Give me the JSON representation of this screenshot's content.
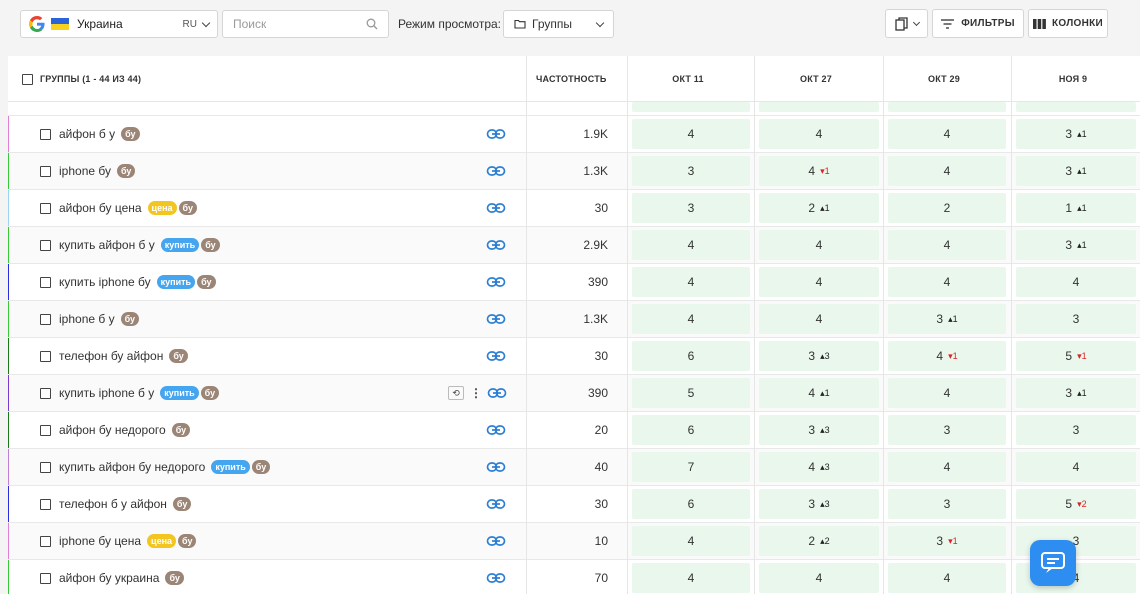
{
  "toolbar": {
    "region_name": "Украина",
    "region_lang": "RU",
    "search_placeholder": "Поиск",
    "view_mode_label": "Режим просмотра:",
    "view_mode_value": "Группы",
    "filters_label": "ФИЛЬТРЫ",
    "columns_label": "КОЛОНКИ"
  },
  "table": {
    "header_groups": "ГРУППЫ (1 - 44 ИЗ 44)",
    "header_freq": "ЧАСТОТНОСТЬ",
    "dates": [
      "ОКТ 11",
      "ОКТ 27",
      "ОКТ 29",
      "НОЯ 9"
    ],
    "rows": [
      {
        "kw": "айфон б у",
        "tags": [
          "бу"
        ],
        "freq": "1.9K",
        "pos": [
          {
            "v": "4"
          },
          {
            "v": "4"
          },
          {
            "v": "4"
          },
          {
            "v": "3",
            "d": "1",
            "dir": "up"
          }
        ]
      },
      {
        "kw": "iphone бу",
        "tags": [
          "бу"
        ],
        "freq": "1.3K",
        "pos": [
          {
            "v": "3"
          },
          {
            "v": "4",
            "d": "1",
            "dir": "down"
          },
          {
            "v": "4"
          },
          {
            "v": "3",
            "d": "1",
            "dir": "up"
          }
        ]
      },
      {
        "kw": "айфон бу цена",
        "tags": [
          "цена",
          "бу"
        ],
        "freq": "30",
        "pos": [
          {
            "v": "3"
          },
          {
            "v": "2",
            "d": "1",
            "dir": "up"
          },
          {
            "v": "2"
          },
          {
            "v": "1",
            "d": "1",
            "dir": "up"
          }
        ]
      },
      {
        "kw": "купить айфон б у",
        "tags": [
          "купить",
          "бу"
        ],
        "freq": "2.9K",
        "pos": [
          {
            "v": "4"
          },
          {
            "v": "4"
          },
          {
            "v": "4"
          },
          {
            "v": "3",
            "d": "1",
            "dir": "up"
          }
        ]
      },
      {
        "kw": "купить iphone бу",
        "tags": [
          "купить",
          "бу"
        ],
        "freq": "390",
        "pos": [
          {
            "v": "4"
          },
          {
            "v": "4"
          },
          {
            "v": "4"
          },
          {
            "v": "4"
          }
        ]
      },
      {
        "kw": "iphone б у",
        "tags": [
          "бу"
        ],
        "freq": "1.3K",
        "pos": [
          {
            "v": "4"
          },
          {
            "v": "4"
          },
          {
            "v": "3",
            "d": "1",
            "dir": "up"
          },
          {
            "v": "3"
          }
        ]
      },
      {
        "kw": "телефон бу айфон",
        "tags": [
          "бу"
        ],
        "freq": "30",
        "pos": [
          {
            "v": "6"
          },
          {
            "v": "3",
            "d": "3",
            "dir": "up"
          },
          {
            "v": "4",
            "d": "1",
            "dir": "down"
          },
          {
            "v": "5",
            "d": "1",
            "dir": "down"
          }
        ]
      },
      {
        "kw": "купить iphone б у",
        "tags": [
          "купить",
          "бу"
        ],
        "freq": "390",
        "pos": [
          {
            "v": "5"
          },
          {
            "v": "4",
            "d": "1",
            "dir": "up"
          },
          {
            "v": "4"
          },
          {
            "v": "3",
            "d": "1",
            "dir": "up"
          }
        ],
        "hover": true
      },
      {
        "kw": "айфон бу недорого",
        "tags": [
          "бу"
        ],
        "freq": "20",
        "pos": [
          {
            "v": "6"
          },
          {
            "v": "3",
            "d": "3",
            "dir": "up"
          },
          {
            "v": "3"
          },
          {
            "v": "3"
          }
        ]
      },
      {
        "kw": "купить айфон бу недорого",
        "tags": [
          "купить",
          "бу"
        ],
        "freq": "40",
        "pos": [
          {
            "v": "7"
          },
          {
            "v": "4",
            "d": "3",
            "dir": "up"
          },
          {
            "v": "4"
          },
          {
            "v": "4"
          }
        ]
      },
      {
        "kw": "телефон б у айфон",
        "tags": [
          "бу"
        ],
        "freq": "30",
        "pos": [
          {
            "v": "6"
          },
          {
            "v": "3",
            "d": "3",
            "dir": "up"
          },
          {
            "v": "3"
          },
          {
            "v": "5",
            "d": "2",
            "dir": "down"
          }
        ]
      },
      {
        "kw": "iphone бу цена",
        "tags": [
          "цена",
          "бу"
        ],
        "freq": "10",
        "pos": [
          {
            "v": "4"
          },
          {
            "v": "2",
            "d": "2",
            "dir": "up"
          },
          {
            "v": "3",
            "d": "1",
            "dir": "down"
          },
          {
            "v": "3"
          }
        ]
      },
      {
        "kw": "айфон бу украина",
        "tags": [
          "бу"
        ],
        "freq": "70",
        "pos": [
          {
            "v": "4"
          },
          {
            "v": "4"
          },
          {
            "v": "4"
          },
          {
            "v": "4"
          }
        ]
      }
    ]
  },
  "colors": {
    "pos_bg": "#e9f7ec",
    "tag_bu": "#9b8576",
    "tag_cena": "#f2c521",
    "tag_kupit": "#45a5ef",
    "link": "#2d7fd3",
    "chat": "#2d8df0",
    "row_bars": [
      "#e07fd6",
      "#37c837",
      "#9ad4f0",
      "#37c837",
      "#2a2ae0",
      "#37c837",
      "#1a7a1a",
      "#7a3ad0",
      "#1a7a1a",
      "#c07fd6",
      "#2a2ae0",
      "#e07fd6",
      "#37c837"
    ]
  },
  "icons": {
    "google": "google-logo",
    "flag": "ukraine-flag-icon",
    "search": "search-icon",
    "folder": "folder-icon",
    "copy": "copy-icon",
    "filter": "filter-icon",
    "columns": "columns-icon",
    "link": "link-icon",
    "history": "history-icon",
    "more": "more-vertical-icon",
    "chat": "chat-icon"
  }
}
